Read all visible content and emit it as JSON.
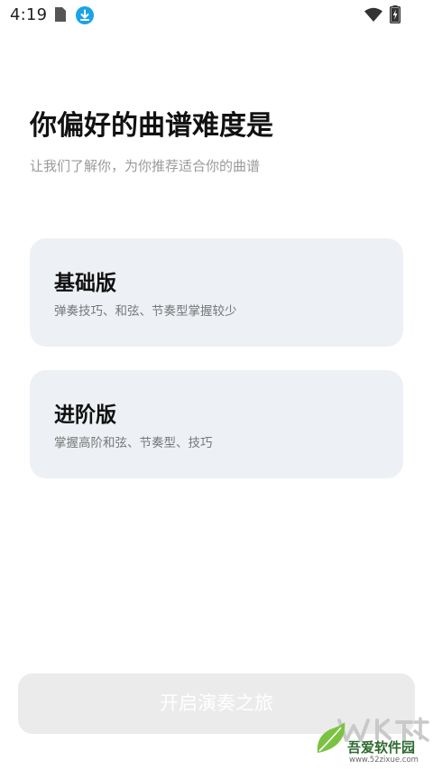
{
  "status_bar": {
    "time": "4:19",
    "icons": [
      "sim-card-icon",
      "download-icon",
      "wifi-icon",
      "battery-charging-icon"
    ]
  },
  "header": {
    "title": "你偏好的曲谱难度是",
    "subtitle": "让我们了解你，为你推荐适合你的曲谱"
  },
  "options": [
    {
      "title": "基础版",
      "description": "弹奏技巧、和弦、节奏型掌握较少"
    },
    {
      "title": "进阶版",
      "description": "掌握高阶和弦、节奏型、技巧"
    }
  ],
  "start_button": {
    "label": "开启演奏之旅",
    "enabled": false
  },
  "watermark": {
    "brand": "吾爱软件园",
    "url": "www.52zixue.com"
  },
  "colors": {
    "card_background": "#edf1f5",
    "button_disabled_background": "#ebebeb",
    "subtitle_text": "#9a9a9a",
    "accent_download": "#1aa3e8"
  }
}
